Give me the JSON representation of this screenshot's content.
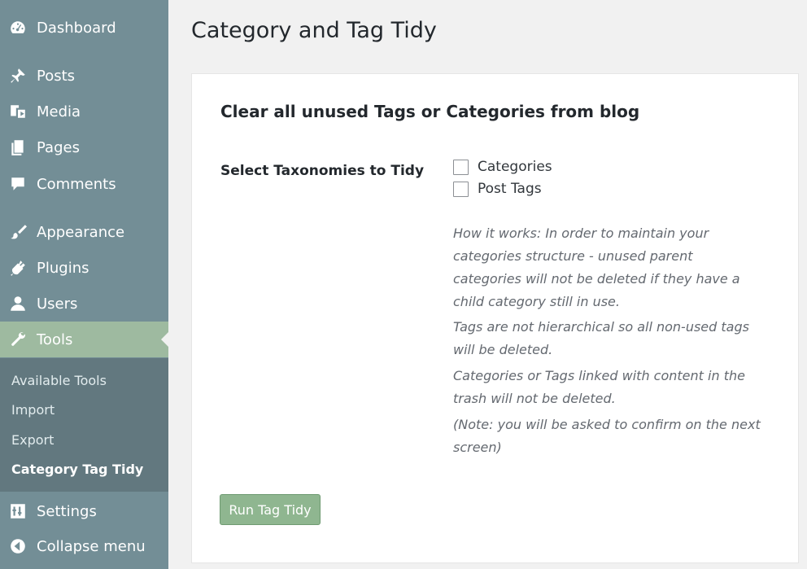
{
  "sidebar": {
    "menu": {
      "dashboard": "Dashboard",
      "posts": "Posts",
      "media": "Media",
      "pages": "Pages",
      "comments": "Comments",
      "appearance": "Appearance",
      "plugins": "Plugins",
      "users": "Users",
      "tools": "Tools",
      "settings": "Settings",
      "collapse": "Collapse menu"
    },
    "submenu": {
      "available_tools": "Available Tools",
      "import": "Import",
      "export": "Export",
      "category_tag_tidy": "Category Tag Tidy"
    }
  },
  "page": {
    "title": "Category and Tag Tidy",
    "section_heading": "Clear all unused Tags or Categories from blog",
    "field_label": "Select Taxonomies to Tidy",
    "options": {
      "categories": "Categories",
      "post_tags": "Post Tags"
    },
    "descriptions": {
      "p1": "How it works: In order to maintain your categories structure - unused parent categories will not be deleted if they have a child category still in use.",
      "p2": "Tags are not hierarchical so all non-used tags will be deleted.",
      "p3": "Categories or Tags linked with content in the trash will not be deleted.",
      "p4": "(Note: you will be asked to confirm on the next screen)"
    },
    "run_button": "Run Tag Tidy"
  },
  "colors": {
    "sidebar_bg": "#738e96",
    "submenu_bg": "#62787f",
    "current_item_bg": "#9ebaa0",
    "button_bg": "#8fb690"
  }
}
